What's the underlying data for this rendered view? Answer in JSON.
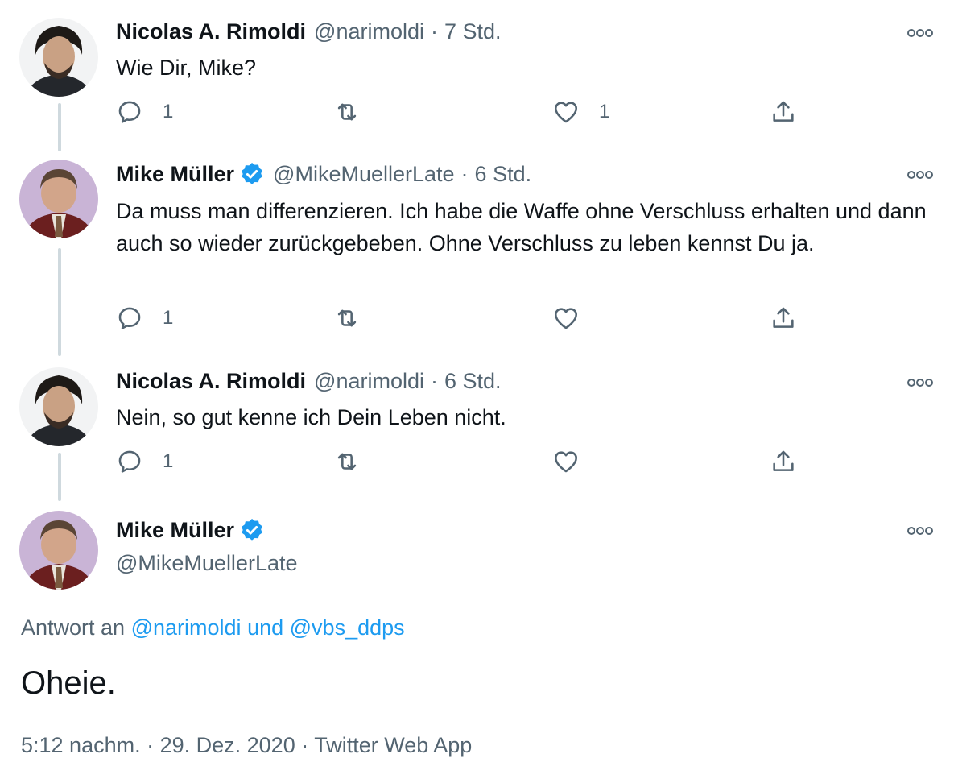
{
  "tweets": [
    {
      "name": "Nicolas A. Rimoldi",
      "handle": "@narimoldi",
      "sep": "·",
      "time": "7 Std.",
      "verified": false,
      "text": "Wie Dir, Mike?",
      "reply_count": "1",
      "retweet_count": "",
      "like_count": "1"
    },
    {
      "name": "Mike Müller",
      "handle": "@MikeMuellerLate",
      "sep": "·",
      "time": "6 Std.",
      "verified": true,
      "text": "Da muss man differenzieren. Ich habe die Waffe ohne Verschluss erhalten und dann auch so wieder zurückgebeben. Ohne Verschluss zu leben kennst Du ja.",
      "reply_count": "1",
      "retweet_count": "",
      "like_count": ""
    },
    {
      "name": "Nicolas A. Rimoldi",
      "handle": "@narimoldi",
      "sep": "·",
      "time": "6 Std.",
      "verified": false,
      "text": "Nein, so gut kenne ich Dein Leben nicht.",
      "reply_count": "1",
      "retweet_count": "",
      "like_count": ""
    }
  ],
  "focus": {
    "name": "Mike Müller",
    "handle": "@MikeMuellerLate",
    "reply_prefix": "Antwort an",
    "reply_user1": "@narimoldi",
    "reply_and": "und",
    "reply_user2": "@vbs_ddps",
    "text": "Oheie.",
    "timestamp": "5:12 nachm. · 29. Dez. 2020 · Twitter Web App"
  },
  "icons": {
    "reply": "reply-icon",
    "retweet": "retweet-icon",
    "like": "heart-icon",
    "share": "share-icon",
    "more": "more-icon",
    "verified": "verified-badge-icon"
  },
  "colors": {
    "link": "#1d9bf0",
    "secondary": "#536471",
    "primary": "#0f1419",
    "verified": "#1d9bf0",
    "thread_line": "#cfd9de"
  }
}
